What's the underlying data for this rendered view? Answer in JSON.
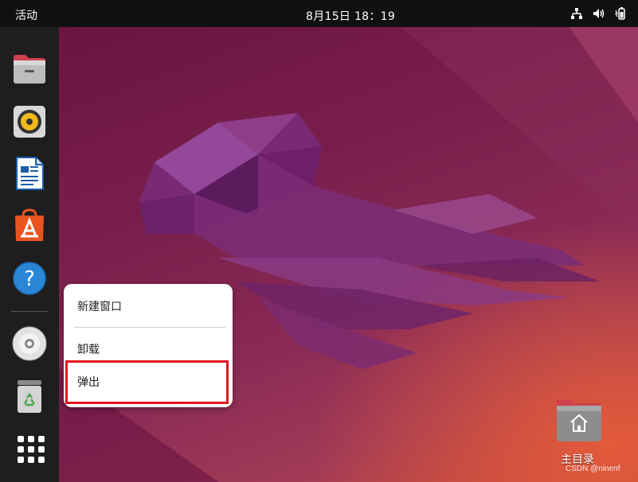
{
  "topbar": {
    "activities_label": "活动",
    "clock": "8月15日  18：19",
    "tray_icons": [
      "network-icon",
      "volume-icon",
      "battery-icon"
    ]
  },
  "dock": {
    "items": [
      {
        "name": "files",
        "icon": "folder-icon"
      },
      {
        "name": "rhythmbox",
        "icon": "speaker-icon"
      },
      {
        "name": "libreoffice-writer",
        "icon": "document-icon"
      },
      {
        "name": "software",
        "icon": "app-store-icon"
      },
      {
        "name": "help",
        "icon": "help-icon"
      },
      {
        "name": "disc",
        "icon": "disc-icon"
      },
      {
        "name": "trash",
        "icon": "trash-icon"
      },
      {
        "name": "show-apps",
        "icon": "app-grid-icon"
      }
    ],
    "help_glyph": "?"
  },
  "context_menu": {
    "items": [
      {
        "label": "新建窗口"
      },
      {
        "label": "卸载"
      },
      {
        "label": "弹出"
      }
    ]
  },
  "desktop": {
    "home_label": "主目录",
    "watermark": "CSDN @ninenf"
  },
  "colors": {
    "highlight": "#e0161e",
    "topbar": "#111111",
    "dock": "#1e1e1e"
  }
}
